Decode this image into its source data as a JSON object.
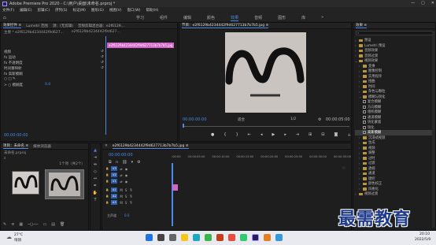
{
  "app": {
    "title": "Adobe Premiere Pro 2020 - C:\\用户\\桌面\\未命名.prproj *",
    "window_controls": [
      "—",
      "▢",
      "✕"
    ]
  },
  "menubar": [
    "文件(F)",
    "编辑(E)",
    "剪辑(C)",
    "序列(S)",
    "标记(M)",
    "图形(G)",
    "视图(V)",
    "窗口(W)",
    "帮助(H)"
  ],
  "workspaces": {
    "tabs": [
      "学习",
      "组件",
      "编辑",
      "颜色",
      "效果",
      "音频",
      "图形",
      "库"
    ],
    "active": "效果",
    "more": "»"
  },
  "effect_controls": {
    "tabs": [
      "效果控件 ≡",
      "Lumetri 范围",
      "源：(无剪辑)",
      "音频剪辑混合器：e2f6129..."
    ],
    "header_clip": "主要 * e2f6129b4234442f9d627...",
    "header_seq": "e2f6129b4234442f9d627...",
    "clip_label": "e2f6129b4234442f9d627713b7b7b5.jpg",
    "section": "视频",
    "rows": [
      {
        "label": "fx  运动",
        "value": ""
      },
      {
        "label": "fx  不透明度",
        "value": ""
      },
      {
        "label": "   时间重映射",
        "value": ""
      },
      {
        "label": "fx  高斯模糊",
        "value": ""
      },
      {
        "label": "○ □ ✎",
        "value": ""
      },
      {
        "label": "> ○ 模糊度",
        "value": "0.0"
      }
    ],
    "footer_time": "00:00:00:00"
  },
  "program": {
    "title": "节目：e2f6129b4234442f9d627713b7b7b5.jpg ≡",
    "timecode_left": "00:00:00:00",
    "fit": "适合",
    "quality": "1/2",
    "timecode_right": "00:00:05:00"
  },
  "effects_panel": {
    "title": "效果 ≡",
    "search_placeholder": "",
    "items": [
      {
        "indent": 1,
        "label": "预设",
        "open": false
      },
      {
        "indent": 1,
        "label": "Lumetri 预设",
        "open": false
      },
      {
        "indent": 1,
        "label": "音频效果",
        "open": false
      },
      {
        "indent": 1,
        "label": "音频过渡",
        "open": false
      },
      {
        "indent": 1,
        "label": "视频效果",
        "open": true
      },
      {
        "indent": 2,
        "label": "变换",
        "open": false
      },
      {
        "indent": 2,
        "label": "图像控制",
        "open": false
      },
      {
        "indent": 2,
        "label": "实用程序",
        "open": false
      },
      {
        "indent": 2,
        "label": "扭曲",
        "open": false
      },
      {
        "indent": 2,
        "label": "时间",
        "open": false
      },
      {
        "indent": 2,
        "label": "杂色与颗粒",
        "open": false
      },
      {
        "indent": 2,
        "label": "模糊与锐化",
        "open": true
      },
      {
        "indent": 3,
        "label": "复合模糊",
        "fx": true
      },
      {
        "indent": 3,
        "label": "方向模糊",
        "fx": true
      },
      {
        "indent": 3,
        "label": "相机模糊",
        "fx": true
      },
      {
        "indent": 3,
        "label": "通道模糊",
        "fx": true
      },
      {
        "indent": 3,
        "label": "钝化蒙版",
        "fx": true
      },
      {
        "indent": 3,
        "label": "锐化",
        "fx": true
      },
      {
        "indent": 3,
        "label": "高斯模糊",
        "fx": true,
        "selected": true
      },
      {
        "indent": 2,
        "label": "沉浸式视频",
        "open": false
      },
      {
        "indent": 2,
        "label": "生成",
        "open": false
      },
      {
        "indent": 2,
        "label": "视频",
        "open": false
      },
      {
        "indent": 2,
        "label": "调整",
        "open": false
      },
      {
        "indent": 2,
        "label": "过时",
        "open": false
      },
      {
        "indent": 2,
        "label": "过渡",
        "open": false
      },
      {
        "indent": 2,
        "label": "透视",
        "open": false
      },
      {
        "indent": 2,
        "label": "通道",
        "open": false
      },
      {
        "indent": 2,
        "label": "键控",
        "open": false
      },
      {
        "indent": 2,
        "label": "颜色校正",
        "open": false
      },
      {
        "indent": 2,
        "label": "风格化",
        "open": false
      },
      {
        "indent": 1,
        "label": "视频过渡",
        "open": false
      }
    ]
  },
  "project": {
    "tabs": [
      "项目：未命名 ≡",
      "媒体浏览器"
    ],
    "path": "未命名.prproj",
    "count": "1个项（共2个）"
  },
  "timeline": {
    "title": "e2f6129b4234442f9d627713b7b7b5.jpg ≡",
    "timecode": "00:00:00:00",
    "ruler": [
      ":00:00",
      "00:00:05:00",
      "00:00:10:00",
      "00:00:15:00",
      "00:00:20:00",
      "00:00:25:00",
      "00:00:30:00",
      "00:00:35:00"
    ],
    "video_tracks": [
      "V3",
      "V2",
      "V1"
    ],
    "audio_tracks": [
      "A1",
      "A2",
      "A3"
    ],
    "master_label": "主声道",
    "master_value": "0.0"
  },
  "watermark": "最需教育",
  "taskbar": {
    "weather_temp": "27°C",
    "weather_text": "晴朗",
    "time": "20:10",
    "date": "2022/5/9"
  }
}
